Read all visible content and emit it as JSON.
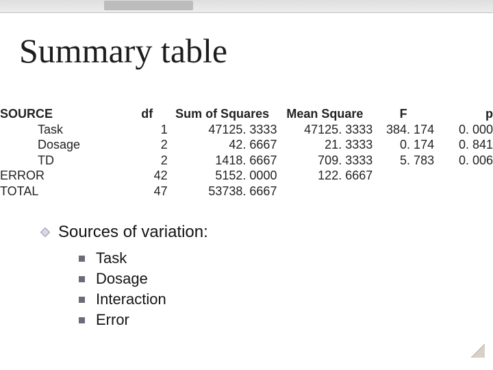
{
  "title": "Summary table",
  "chart_data": {
    "type": "table",
    "columns": [
      "SOURCE",
      "df",
      "Sum of Squares",
      "Mean Square",
      "F",
      "p"
    ],
    "rows": [
      {
        "source": "Task",
        "df": "1",
        "ss": "47125. 3333",
        "ms": "47125. 3333",
        "f": "384. 174",
        "p": "0. 000",
        "indent": true
      },
      {
        "source": "Dosage",
        "df": "2",
        "ss": "42. 6667",
        "ms": "21. 3333",
        "f": "0. 174",
        "p": "0. 841",
        "indent": true
      },
      {
        "source": "TD",
        "df": "2",
        "ss": "1418. 6667",
        "ms": "709. 3333",
        "f": "5. 783",
        "p": "0. 006",
        "indent": true
      },
      {
        "source": "ERROR",
        "df": "42",
        "ss": "5152. 0000",
        "ms": "122. 6667",
        "f": "",
        "p": ""
      },
      {
        "source": "TOTAL",
        "df": "47",
        "ss": "53738. 6667",
        "ms": "",
        "f": "",
        "p": ""
      }
    ]
  },
  "subhead": "Sources of variation:",
  "bullets": [
    "Task",
    "Dosage",
    "Interaction",
    "Error"
  ]
}
